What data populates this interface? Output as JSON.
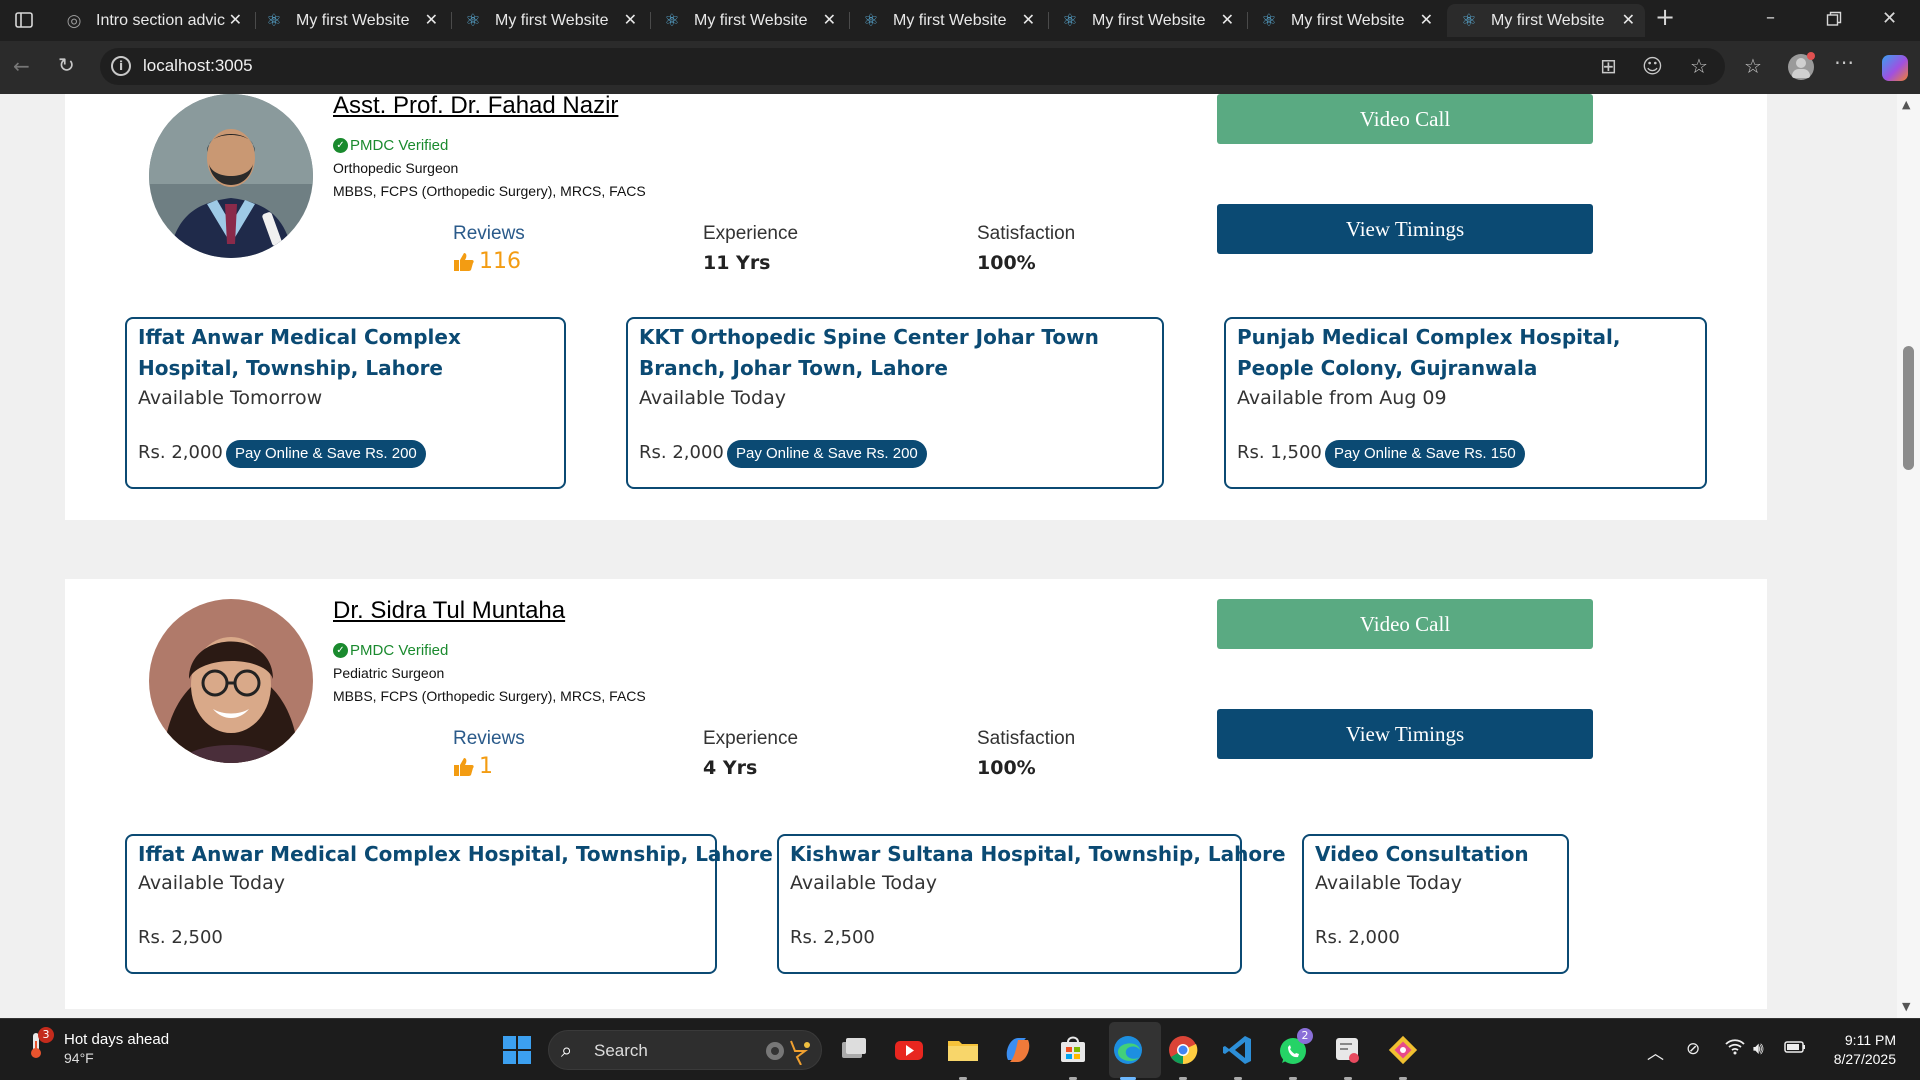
{
  "browser": {
    "tabs": [
      {
        "title": "Intro section advic",
        "favicon": "generic-page-icon"
      },
      {
        "title": "My first Website",
        "favicon": "react-icon"
      },
      {
        "title": "My first Website",
        "favicon": "react-icon"
      },
      {
        "title": "My first Website",
        "favicon": "react-icon"
      },
      {
        "title": "My first Website",
        "favicon": "react-icon"
      },
      {
        "title": "My first Website",
        "favicon": "react-icon"
      },
      {
        "title": "My first Website",
        "favicon": "react-icon"
      },
      {
        "title": "My first Website",
        "favicon": "react-icon",
        "active": true
      }
    ],
    "url": "localhost:3005"
  },
  "doctors": [
    {
      "name": "Asst. Prof. Dr. Fahad Nazir",
      "verified": "PMDC Verified",
      "specialty": "Orthopedic Surgeon",
      "qualifications": "MBBS, FCPS (Orthopedic Surgery), MRCS, FACS",
      "reviews_label": "Reviews",
      "reviews": "116",
      "experience_label": "Experience",
      "experience": "11 Yrs",
      "satisfaction_label": "Satisfaction",
      "satisfaction": "100%",
      "video_call": "Video Call",
      "view_timings": "View Timings",
      "locations": [
        {
          "name": "Iffat Anwar Medical Complex Hospital, Township, Lahore",
          "availability": "Available Tomorrow",
          "fee": "Rs. 2,000",
          "promo": "Pay Online & Save Rs. 200"
        },
        {
          "name": "KKT Orthopedic Spine Center Johar Town Branch, Johar Town, Lahore",
          "availability": "Available Today",
          "fee": "Rs. 2,000",
          "promo": "Pay Online & Save Rs. 200"
        },
        {
          "name": "Punjab Medical Complex Hospital, People Colony, Gujranwala",
          "availability": "Available from Aug 09",
          "fee": "Rs. 1,500",
          "promo": "Pay Online & Save Rs. 150"
        }
      ]
    },
    {
      "name": "Dr. Sidra Tul Muntaha",
      "verified": "PMDC Verified",
      "specialty": "Pediatric Surgeon",
      "qualifications": "MBBS, FCPS (Orthopedic Surgery), MRCS, FACS",
      "reviews_label": "Reviews",
      "reviews": "1",
      "experience_label": "Experience",
      "experience": "4 Yrs",
      "satisfaction_label": "Satisfaction",
      "satisfaction": "100%",
      "video_call": "Video Call",
      "view_timings": "View Timings",
      "locations": [
        {
          "name": "Iffat Anwar Medical Complex Hospital, Township, Lahore",
          "availability": "Available Today",
          "fee": "Rs. 2,500"
        },
        {
          "name": "Kishwar Sultana Hospital, Township, Lahore",
          "availability": "Available Today",
          "fee": "Rs. 2,500"
        },
        {
          "name": "Video Consultation",
          "availability": "Available Today",
          "fee": "Rs. 2,000"
        }
      ]
    }
  ],
  "taskbar": {
    "weather_title": "Hot days ahead",
    "weather_temp": "94°F",
    "weather_badge": "3",
    "search_label": "Search",
    "whatsapp_badge": "2",
    "time": "9:11 PM",
    "date": "8/27/2025"
  },
  "colors": {
    "primary": "#0b4a73",
    "video_button": "#5aaa82",
    "verified": "#1a8a2e",
    "reviews_accent": "#f39c12"
  }
}
